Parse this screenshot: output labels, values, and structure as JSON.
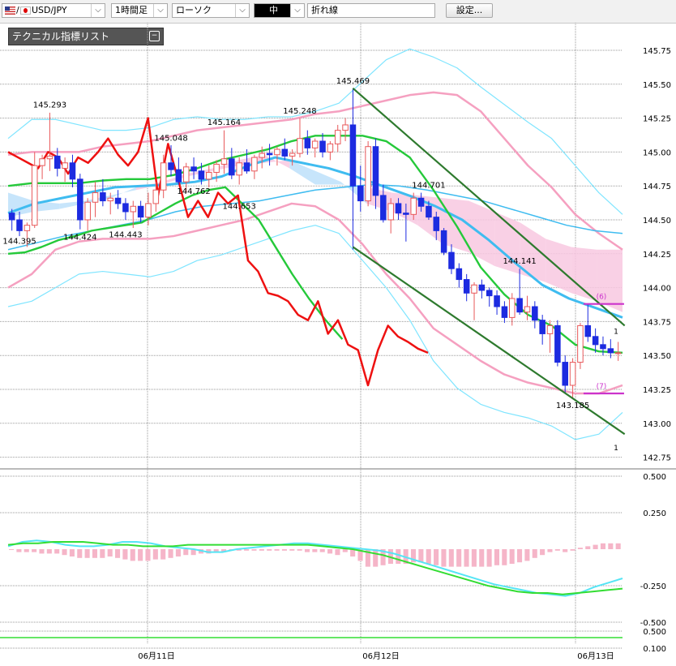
{
  "toolbar": {
    "symbol": "USD/JPY",
    "timeframe": "1時間足",
    "chart_style": "ローソク",
    "size": "中",
    "tool": "折れ線",
    "settings_button": "設定..."
  },
  "indicator_panel": {
    "title": "テクニカル指標リスト",
    "toggle_icon": "minus-box-icon"
  },
  "colors": {
    "bull_candle": "#e8585a",
    "bear_candle": "#1c2be0",
    "bollinger_outer": "#7fe5ff",
    "bollinger_inner": "#f5a0c0",
    "ma_short": "#25c93a",
    "ma_long": "#3fbcf0",
    "lagging_line": "#ee1111",
    "cloud": "#bde0fa",
    "cloud_bear": "#f8c8e0",
    "channel": "#2e7a2e",
    "macd_hist": "#f5b5c8",
    "macd_line": "#55e5f5",
    "signal_line": "#33dd33",
    "counter_mark": "#cc33cc"
  },
  "chart_data": [
    {
      "type": "candlestick",
      "symbol": "USD/JPY",
      "interval": "1時間足",
      "ylim": [
        142.75,
        145.75
      ],
      "y_ticks": [
        "145.75",
        "145.50",
        "145.25",
        "145.00",
        "144.75",
        "144.50",
        "144.25",
        "144.00",
        "143.75",
        "143.50",
        "143.25",
        "143.00",
        "142.75"
      ],
      "x_labels": [
        "06月11日",
        "06月12日",
        "06月13日"
      ],
      "ohlc": [
        [
          144.55,
          144.58,
          144.42,
          144.5
        ],
        [
          144.5,
          144.56,
          144.38,
          144.42
        ],
        [
          144.42,
          144.48,
          144.3,
          144.46
        ],
        [
          144.46,
          145.0,
          144.44,
          144.9
        ],
        [
          144.9,
          144.98,
          144.8,
          144.95
        ],
        [
          144.95,
          145.29,
          144.86,
          144.97
        ],
        [
          144.97,
          145.03,
          144.82,
          144.88
        ],
        [
          144.88,
          144.96,
          144.78,
          144.92
        ],
        [
          144.92,
          144.98,
          144.74,
          144.8
        ],
        [
          144.8,
          144.84,
          144.43,
          144.5
        ],
        [
          144.5,
          144.66,
          144.42,
          144.63
        ],
        [
          144.63,
          144.78,
          144.52,
          144.7
        ],
        [
          144.7,
          144.8,
          144.6,
          144.64
        ],
        [
          144.64,
          144.7,
          144.54,
          144.66
        ],
        [
          144.66,
          144.72,
          144.58,
          144.62
        ],
        [
          144.62,
          144.66,
          144.5,
          144.56
        ],
        [
          144.56,
          144.64,
          144.44,
          144.6
        ],
        [
          144.6,
          144.64,
          144.48,
          144.52
        ],
        [
          144.52,
          144.7,
          144.46,
          144.62
        ],
        [
          144.62,
          144.78,
          144.56,
          144.72
        ],
        [
          144.72,
          144.98,
          144.66,
          144.92
        ],
        [
          144.92,
          145.05,
          144.82,
          144.87
        ],
        [
          144.87,
          144.96,
          144.76,
          144.78
        ],
        [
          144.78,
          144.92,
          144.7,
          144.89
        ],
        [
          144.89,
          144.96,
          144.8,
          144.86
        ],
        [
          144.86,
          144.92,
          144.76,
          144.8
        ],
        [
          144.8,
          144.9,
          144.74,
          144.85
        ],
        [
          144.85,
          144.94,
          144.78,
          144.91
        ],
        [
          144.91,
          145.16,
          144.84,
          144.95
        ],
        [
          144.95,
          145.03,
          144.8,
          144.83
        ],
        [
          144.83,
          144.96,
          144.76,
          144.92
        ],
        [
          144.92,
          145.02,
          144.84,
          144.86
        ],
        [
          144.86,
          144.98,
          144.8,
          144.96
        ],
        [
          144.96,
          145.04,
          144.88,
          144.99
        ],
        [
          144.99,
          145.06,
          144.9,
          144.98
        ],
        [
          144.98,
          145.04,
          144.9,
          145.02
        ],
        [
          145.02,
          145.1,
          144.94,
          144.97
        ],
        [
          144.97,
          145.02,
          144.9,
          144.99
        ],
        [
          144.99,
          145.25,
          144.96,
          145.1
        ],
        [
          145.1,
          145.16,
          144.98,
          145.03
        ],
        [
          145.03,
          145.1,
          144.96,
          145.08
        ],
        [
          145.08,
          145.14,
          144.96,
          145.0
        ],
        [
          145.0,
          145.08,
          144.94,
          145.06
        ],
        [
          145.06,
          145.2,
          145.0,
          145.16
        ],
        [
          145.16,
          145.25,
          145.08,
          145.2
        ],
        [
          145.2,
          145.47,
          144.28,
          144.75
        ],
        [
          144.75,
          144.9,
          144.56,
          144.64
        ],
        [
          144.64,
          145.08,
          144.6,
          145.04
        ],
        [
          145.04,
          145.1,
          144.58,
          144.68
        ],
        [
          144.68,
          144.76,
          144.48,
          144.5
        ],
        [
          144.5,
          144.66,
          144.4,
          144.62
        ],
        [
          144.62,
          144.66,
          144.5,
          144.55
        ],
        [
          144.55,
          144.62,
          144.34,
          144.54
        ],
        [
          144.54,
          144.7,
          144.5,
          144.66
        ],
        [
          144.66,
          144.7,
          144.56,
          144.6
        ],
        [
          144.6,
          144.64,
          144.5,
          144.52
        ],
        [
          144.52,
          144.56,
          144.35,
          144.42
        ],
        [
          144.42,
          144.44,
          144.24,
          144.26
        ],
        [
          144.26,
          144.32,
          144.1,
          144.14
        ],
        [
          144.14,
          144.18,
          144.0,
          144.06
        ],
        [
          144.06,
          144.1,
          143.9,
          143.96
        ],
        [
          143.96,
          144.04,
          143.76,
          144.02
        ],
        [
          144.02,
          144.06,
          143.92,
          143.98
        ],
        [
          143.98,
          144.0,
          143.86,
          143.94
        ],
        [
          143.94,
          143.98,
          143.8,
          143.86
        ],
        [
          143.86,
          143.9,
          143.74,
          143.78
        ],
        [
          143.78,
          143.96,
          143.72,
          143.92
        ],
        [
          143.92,
          144.14,
          143.8,
          143.82
        ],
        [
          143.82,
          143.94,
          143.76,
          143.86
        ],
        [
          143.86,
          143.9,
          143.7,
          143.76
        ],
        [
          143.76,
          143.8,
          143.58,
          143.66
        ],
        [
          143.66,
          143.76,
          143.52,
          143.72
        ],
        [
          143.72,
          143.76,
          143.42,
          143.45
        ],
        [
          143.45,
          143.5,
          143.22,
          143.28
        ],
        [
          143.28,
          143.48,
          143.19,
          143.45
        ],
        [
          143.45,
          143.74,
          143.4,
          143.72
        ],
        [
          143.72,
          143.88,
          143.6,
          143.64
        ],
        [
          143.64,
          143.7,
          143.52,
          143.58
        ],
        [
          143.58,
          143.64,
          143.5,
          143.55
        ],
        [
          143.55,
          143.62,
          143.48,
          143.52
        ],
        [
          143.52,
          143.6,
          143.46,
          143.52
        ]
      ],
      "bollinger": {
        "upper2": [
          145.1,
          145.24,
          145.24,
          145.2,
          145.16,
          145.16,
          145.18,
          145.24,
          145.26,
          145.24,
          145.24,
          145.26,
          145.26,
          145.3,
          145.36,
          145.52,
          145.68,
          145.76,
          145.7,
          145.62,
          145.48,
          145.35,
          145.22,
          145.1,
          144.9,
          144.7,
          144.54
        ],
        "upper1": [
          144.98,
          145.0,
          145.0,
          145.0,
          145.04,
          145.06,
          145.08,
          145.12,
          145.16,
          145.18,
          145.2,
          145.22,
          145.24,
          145.28,
          145.3,
          145.34,
          145.38,
          145.42,
          145.44,
          145.42,
          145.3,
          145.1,
          144.9,
          144.74,
          144.54,
          144.4,
          144.28
        ],
        "lower1": [
          144.0,
          144.1,
          144.28,
          144.34,
          144.36,
          144.36,
          144.36,
          144.38,
          144.42,
          144.46,
          144.5,
          144.56,
          144.62,
          144.6,
          144.5,
          144.32,
          144.1,
          143.92,
          143.7,
          143.58,
          143.46,
          143.36,
          143.3,
          143.26,
          143.22,
          143.22,
          143.28
        ],
        "lower2": [
          143.86,
          143.9,
          144.0,
          144.1,
          144.12,
          144.1,
          144.08,
          144.12,
          144.2,
          144.24,
          144.3,
          144.36,
          144.42,
          144.46,
          144.4,
          144.2,
          144.0,
          143.76,
          143.46,
          143.26,
          143.14,
          143.08,
          143.04,
          142.98,
          142.88,
          142.92,
          143.08
        ]
      },
      "ma_short": [
        144.75,
        144.77,
        144.77,
        144.77,
        144.79,
        144.8,
        144.8,
        144.83,
        144.88,
        144.94,
        144.98,
        145.02,
        145.08,
        145.12,
        145.12,
        145.12,
        145.08,
        144.96,
        144.72,
        144.45,
        144.15,
        143.95,
        143.8,
        143.72,
        143.58,
        143.53,
        143.52
      ],
      "ma_long": [
        144.55,
        144.62,
        144.66,
        144.7,
        144.74,
        144.75,
        144.76,
        144.78,
        144.82,
        144.9,
        144.96,
        144.92,
        144.88,
        144.82,
        144.75,
        144.68,
        144.6,
        144.5,
        144.35,
        144.18,
        144.02,
        143.92,
        143.85,
        143.78
      ],
      "cloud": {
        "span_a": [
          144.7,
          144.64,
          144.62,
          144.64,
          144.68,
          144.72,
          144.76,
          144.82,
          144.86,
          144.9,
          144.92,
          144.94,
          144.86,
          144.78,
          144.62,
          144.56,
          144.46,
          144.32,
          144.26,
          144.16,
          144.1,
          144.04,
          143.96,
          143.9,
          143.82
        ],
        "span_b": [
          144.52,
          144.56,
          144.58,
          144.62,
          144.66,
          144.74,
          144.78,
          144.84,
          144.88,
          144.94,
          144.98,
          144.88,
          144.76,
          144.76,
          144.74,
          144.7,
          144.68,
          144.66,
          144.64,
          144.56,
          144.48,
          144.36,
          144.3,
          144.28,
          144.28
        ]
      },
      "ma_lower_green": [
        144.25,
        144.26,
        144.3,
        144.35,
        144.38,
        144.42,
        144.44,
        144.46,
        144.48,
        144.55,
        144.62,
        144.68,
        144.72,
        144.74,
        144.62,
        144.5,
        144.3,
        144.1,
        143.92,
        143.76,
        143.62
      ],
      "trend_line_2": [
        144.28,
        144.33,
        144.38,
        144.42,
        144.46,
        144.5,
        144.56,
        144.6,
        144.62,
        144.64,
        144.68,
        144.72,
        144.74,
        144.76,
        144.75,
        144.72,
        144.68,
        144.64,
        144.58,
        144.52,
        144.46,
        144.42,
        144.4
      ],
      "lagging_span": [
        145.0,
        144.96,
        144.92,
        144.88,
        145.0,
        144.96,
        144.84,
        144.96,
        144.92,
        145.0,
        145.1,
        144.98,
        144.9,
        145.0,
        145.25,
        144.68,
        145.06,
        144.8,
        144.52,
        144.64,
        144.52,
        144.7,
        144.62,
        144.68,
        144.2,
        144.12,
        143.96,
        143.94,
        143.9,
        143.8,
        143.76,
        143.9,
        143.66,
        143.76,
        143.58,
        143.54,
        143.28,
        143.54,
        143.72,
        143.64,
        143.6,
        143.55,
        143.52
      ],
      "channel": {
        "upper": [
          [
            145.47,
            45
          ],
          [
            143.72,
            80
          ]
        ],
        "lower": [
          [
            144.3,
            45
          ],
          [
            142.92,
            80
          ]
        ]
      },
      "annotations": [
        {
          "label": "144.395",
          "price": 144.395,
          "bar": 1
        },
        {
          "label": "145.293",
          "price": 145.293,
          "bar": 5
        },
        {
          "label": "144.424",
          "price": 144.424,
          "bar": 9
        },
        {
          "label": "144.443",
          "price": 144.443,
          "bar": 15
        },
        {
          "label": "145.048",
          "price": 145.048,
          "bar": 21
        },
        {
          "label": "144.762",
          "price": 144.762,
          "bar": 24
        },
        {
          "label": "145.164",
          "price": 145.164,
          "bar": 28
        },
        {
          "label": "144.653",
          "price": 144.653,
          "bar": 30
        },
        {
          "label": "145.248",
          "price": 145.248,
          "bar": 38
        },
        {
          "label": "145.469",
          "price": 145.469,
          "bar": 45
        },
        {
          "label": "144.701",
          "price": 144.701,
          "bar": 55
        },
        {
          "label": "144.141",
          "price": 144.141,
          "bar": 67
        },
        {
          "label": "143.185",
          "price": 143.185,
          "bar": 74
        }
      ],
      "counter_marks": [
        {
          "label": "(6)",
          "price": 143.88,
          "bar": 77
        },
        {
          "label": "(7)",
          "price": 143.22,
          "bar": 77
        }
      ],
      "edge_numbers": [
        "1",
        "1"
      ]
    },
    {
      "type": "macd",
      "y_ticks": [
        "0.500",
        "0.250",
        "-0.250",
        "-0.500"
      ],
      "ylim": [
        -0.55,
        0.55
      ],
      "histogram": [
        0.0,
        -0.02,
        -0.02,
        -0.02,
        -0.03,
        -0.03,
        -0.03,
        -0.04,
        -0.05,
        -0.06,
        -0.06,
        -0.06,
        -0.06,
        -0.05,
        -0.06,
        -0.07,
        -0.08,
        -0.08,
        -0.08,
        -0.07,
        -0.07,
        -0.06,
        -0.05,
        -0.04,
        -0.04,
        -0.03,
        -0.03,
        -0.02,
        -0.02,
        -0.01,
        -0.01,
        -0.01,
        -0.01,
        -0.01,
        -0.01,
        -0.01,
        -0.01,
        -0.01,
        -0.01,
        -0.02,
        -0.02,
        -0.02,
        -0.03,
        -0.04,
        -0.02,
        -0.05,
        -0.08,
        -0.12,
        -0.12,
        -0.11,
        -0.1,
        -0.1,
        -0.1,
        -0.09,
        -0.09,
        -0.1,
        -0.11,
        -0.12,
        -0.12,
        -0.12,
        -0.12,
        -0.12,
        -0.12,
        -0.12,
        -0.11,
        -0.11,
        -0.1,
        -0.09,
        -0.08,
        -0.06,
        -0.04,
        -0.02,
        -0.01,
        -0.02,
        -0.01,
        0.01,
        0.02,
        0.03,
        0.04,
        0.04,
        0.04
      ],
      "macd": [
        0.02,
        0.05,
        0.06,
        0.05,
        0.03,
        0.02,
        0.02,
        0.03,
        0.05,
        0.05,
        0.04,
        0.02,
        0.01,
        0.0,
        -0.02,
        -0.02,
        0.0,
        0.01,
        0.02,
        0.03,
        0.04,
        0.04,
        0.03,
        0.02,
        0.01,
        0.0,
        -0.01,
        -0.03,
        -0.06,
        -0.09,
        -0.12,
        -0.15,
        -0.18,
        -0.21,
        -0.24,
        -0.26,
        -0.28,
        -0.3,
        -0.31,
        -0.32,
        -0.3,
        -0.26,
        -0.23,
        -0.2
      ],
      "signal": [
        0.03,
        0.04,
        0.04,
        0.05,
        0.05,
        0.05,
        0.04,
        0.03,
        0.03,
        0.02,
        0.02,
        0.02,
        0.03,
        0.03,
        0.03,
        0.03,
        0.03,
        0.03,
        0.03,
        0.03,
        0.03,
        0.02,
        0.01,
        0.0,
        -0.02,
        -0.04,
        -0.07,
        -0.1,
        -0.13,
        -0.16,
        -0.19,
        -0.22,
        -0.25,
        -0.27,
        -0.29,
        -0.3,
        -0.3,
        -0.31,
        -0.3,
        -0.29,
        -0.28,
        -0.27
      ],
      "bottom_ticks": [
        "0.500",
        "0.100"
      ]
    }
  ]
}
